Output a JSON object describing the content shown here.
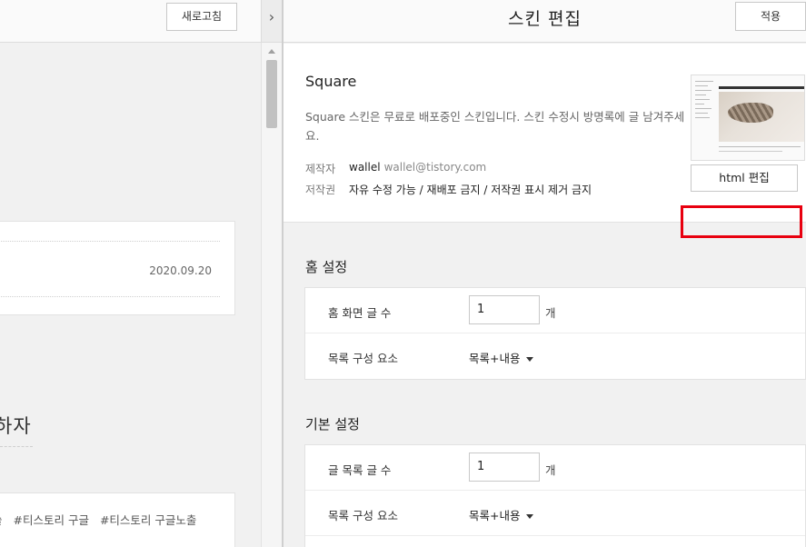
{
  "preview": {
    "refresh_label": "새로고침",
    "toggle_glyph": "›",
    "post_date": "2020.09.20",
    "heading_partial": "하자",
    "tags": [
      "술",
      "#티스토리 구글",
      "#티스토리 구글노출"
    ]
  },
  "editor": {
    "title": "스킨 편집",
    "apply_label": "적용",
    "skin": {
      "name": "Square",
      "description": "Square 스킨은 무료로 배포중인 스킨입니다. 스킨 수정시 방명록에 글 남겨주세요.",
      "author_label": "제작자",
      "author_name": "wallel",
      "author_email": "wallel@tistory.com",
      "license_label": "저작권",
      "license_value": "자유 수정 가능 / 재배포 금지 / 저작권 표시 제거 금지",
      "html_edit_label": "html 편집"
    },
    "home_settings": {
      "title": "홈 설정",
      "rows": [
        {
          "label": "홈 화면 글 수",
          "value": "1",
          "unit": "개"
        },
        {
          "label": "목록 구성 요소",
          "value": "목록+내용"
        }
      ]
    },
    "basic_settings": {
      "title": "기본 설정",
      "rows": [
        {
          "label": "글 목록 글 수",
          "value": "1",
          "unit": "개"
        },
        {
          "label": "목록 구성 요소",
          "value": "목록+내용"
        }
      ]
    }
  },
  "colors": {
    "highlight": "#e8000f"
  }
}
